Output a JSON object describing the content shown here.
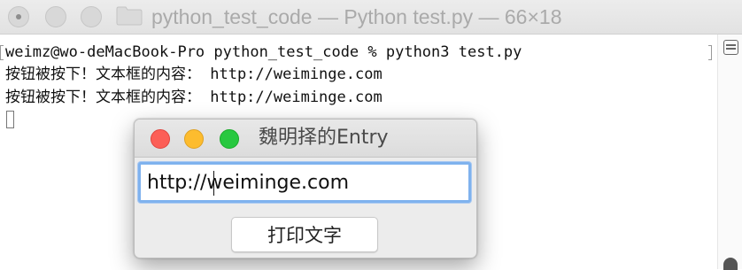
{
  "terminal": {
    "title": "python_test_code — Python test.py — 66×18",
    "folder_icon": "folder-icon",
    "lines": [
      "weimz@wo-deMacBook-Pro python_test_code % python3 test.py",
      "按钮被按下！文本框的内容： http://weiminge.com",
      "按钮被按下！文本框的内容： http://weiminge.com"
    ]
  },
  "tk_window": {
    "title": "魏明择的Entry",
    "entry_value": "http://weiminge.com",
    "button_label": "打印文字"
  },
  "colors": {
    "close": "#fc5f57",
    "minimize": "#fdbc2e",
    "maximize": "#28c840",
    "focus_ring": "#7fb2ee"
  }
}
